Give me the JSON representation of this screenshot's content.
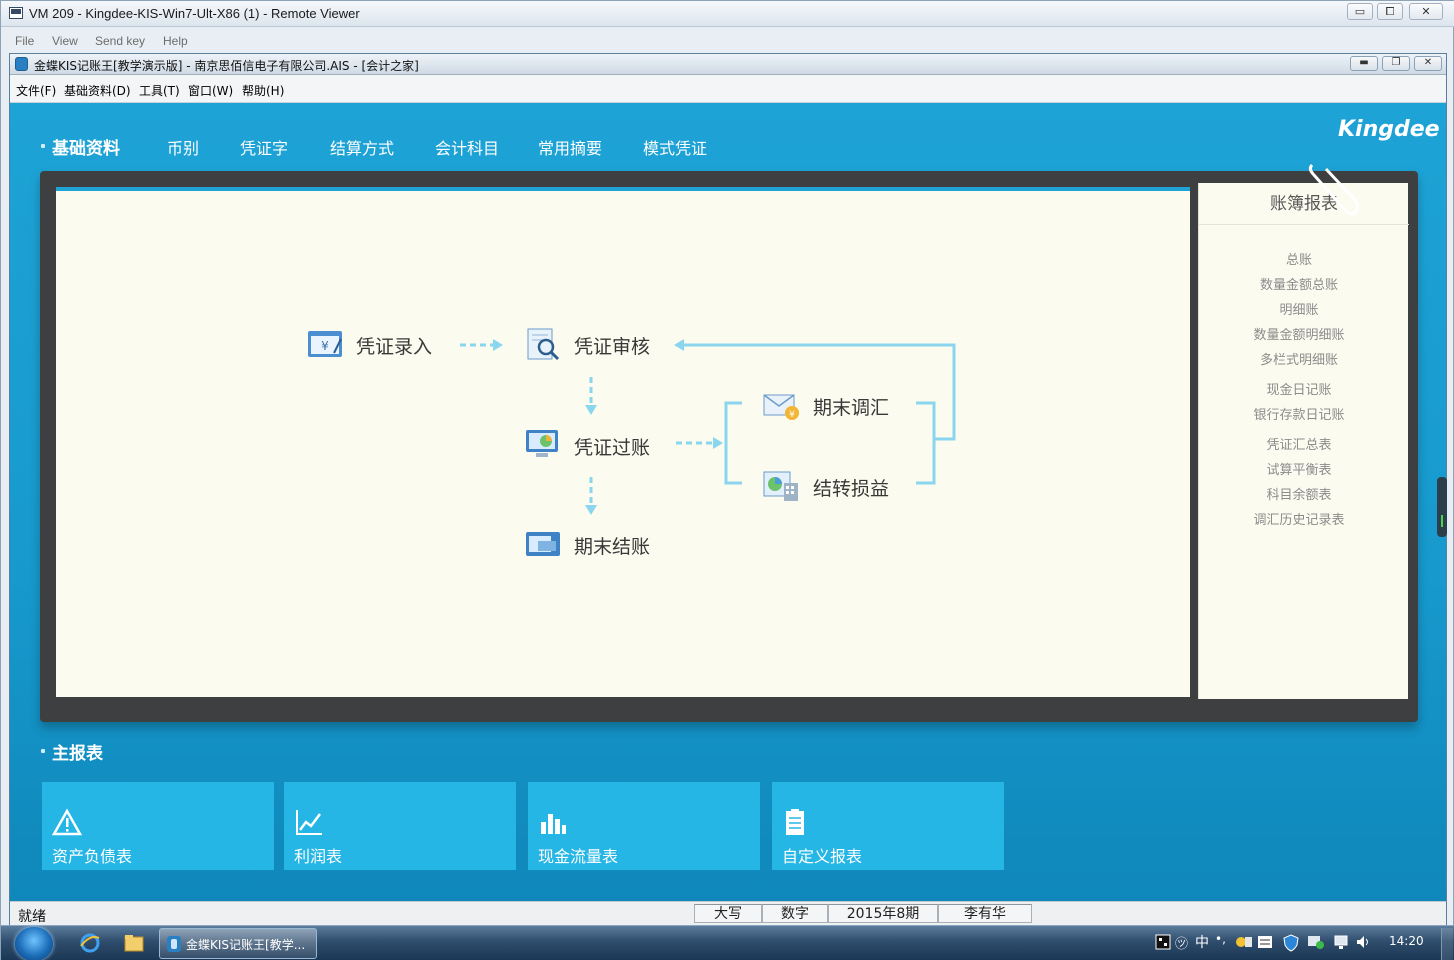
{
  "viewer": {
    "title": "VM 209 - Kingdee-KIS-Win7-Ult-X86 (1) - Remote Viewer",
    "menu": [
      "File",
      "View",
      "Send key",
      "Help"
    ],
    "controls": {
      "minimize": "▭",
      "maximize": "⧠",
      "close": "✕"
    }
  },
  "app": {
    "title": "金蝶KIS记账王[教学演示版] - 南京思佰信电子有限公司.AIS - [会计之家]",
    "menu": [
      "文件(F)",
      "基础资料(D)",
      "工具(T)",
      "窗口(W)",
      "帮助(H)"
    ],
    "controls": {
      "minimize": "▬",
      "restore": "❐",
      "close": "✕"
    }
  },
  "brand": "Kingdee",
  "base_section": {
    "title": "基础资料",
    "tabs": [
      "币别",
      "凭证字",
      "结算方式",
      "会计科目",
      "常用摘要",
      "模式凭证"
    ]
  },
  "flow": {
    "voucher_entry": "凭证录入",
    "voucher_review": "凭证审核",
    "voucher_posting": "凭证过账",
    "period_close": "期末结账",
    "period_adjust": "期末调汇",
    "carry_forward": "结转损益"
  },
  "ledger_panel": {
    "title": "账簿报表",
    "groups": [
      [
        "总账",
        "数量金额总账",
        "明细账",
        "数量金额明细账",
        "多栏式明细账"
      ],
      [
        "现金日记账",
        "银行存款日记账"
      ],
      [
        "凭证汇总表",
        "试算平衡表",
        "科目余额表",
        "调汇历史记录表"
      ]
    ]
  },
  "reports_section": {
    "title": "主报表",
    "tiles": [
      {
        "label": "资产负债表",
        "icon": "warning-triangle-icon"
      },
      {
        "label": "利润表",
        "icon": "line-chart-icon"
      },
      {
        "label": "现金流量表",
        "icon": "bar-chart-icon"
      },
      {
        "label": "自定义报表",
        "icon": "clipboard-icon"
      }
    ]
  },
  "status": {
    "ready": "就绪",
    "caps": "大写",
    "num": "数字",
    "period": "2015年8期",
    "user": "李有华"
  },
  "taskbar": {
    "app_label": "金蝶KIS记账王[教学...",
    "ime": "中",
    "clock": "14:20"
  },
  "colors": {
    "main_blue": "#1a9bcd",
    "tile_blue": "#25b6e6",
    "canvas": "#fcfbef",
    "arrow": "#8ad6ee"
  }
}
